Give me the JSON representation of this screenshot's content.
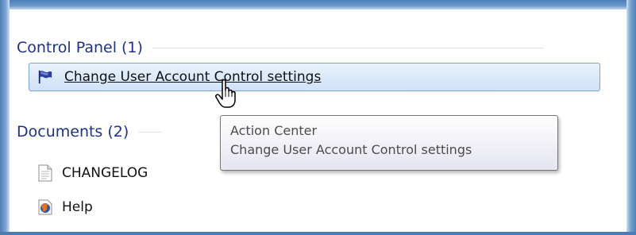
{
  "groups": {
    "control_panel": {
      "title": "Control Panel (1)",
      "items": [
        {
          "label": "Change User Account Control settings",
          "icon": "flag-icon"
        }
      ]
    },
    "documents": {
      "title": "Documents (2)",
      "items": [
        {
          "label": "CHANGELOG",
          "icon": "text-document-icon"
        },
        {
          "label": "Help",
          "icon": "firefox-icon"
        }
      ]
    }
  },
  "tooltip": {
    "line1": "Action Center",
    "line2": "Change User Account Control settings"
  },
  "colors": {
    "group_header": "#1e3287",
    "selection_border": "#7da2ce",
    "selection_fill": "#d9e8f8",
    "frame_blue": "#4d7fb5"
  }
}
